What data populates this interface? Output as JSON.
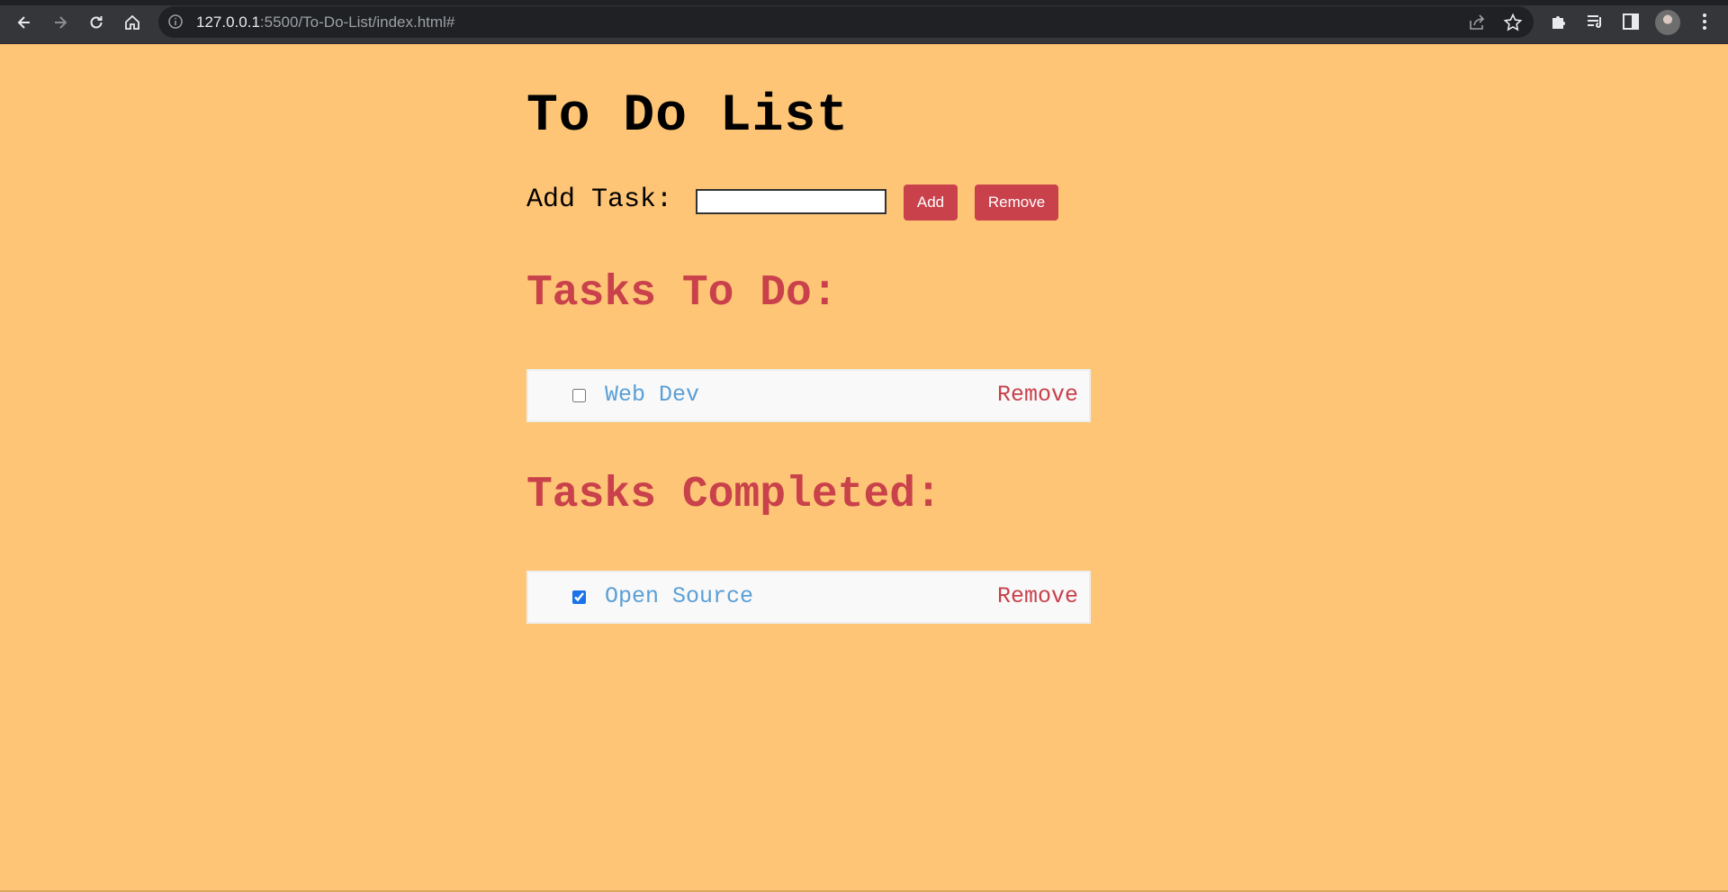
{
  "browser": {
    "url_host": "127.0.0.1",
    "url_rest": ":5500/To-Do-List/index.html#",
    "icons": [
      "back-arrow-icon",
      "forward-arrow-icon",
      "reload-icon",
      "home-icon",
      "info-icon",
      "share-icon",
      "star-icon",
      "puzzle-icon",
      "reading-list-icon",
      "side-panel-icon",
      "avatar",
      "kebab-menu-icon"
    ]
  },
  "page": {
    "title": "To Do List",
    "add_label": "Add Task:",
    "input_value": "",
    "add_button": "Add",
    "remove_button": "Remove",
    "todo_heading": "Tasks To Do:",
    "completed_heading": "Tasks Completed:",
    "todo_tasks": [
      {
        "label": "Web Dev",
        "checked": false,
        "remove": "Remove"
      }
    ],
    "completed_tasks": [
      {
        "label": "Open Source",
        "checked": true,
        "remove": "Remove"
      }
    ]
  },
  "colors": {
    "background": "#ffc576",
    "accent": "#c8414b",
    "task_text": "#5b9fd6",
    "row_bg": "#f9f9f9"
  }
}
